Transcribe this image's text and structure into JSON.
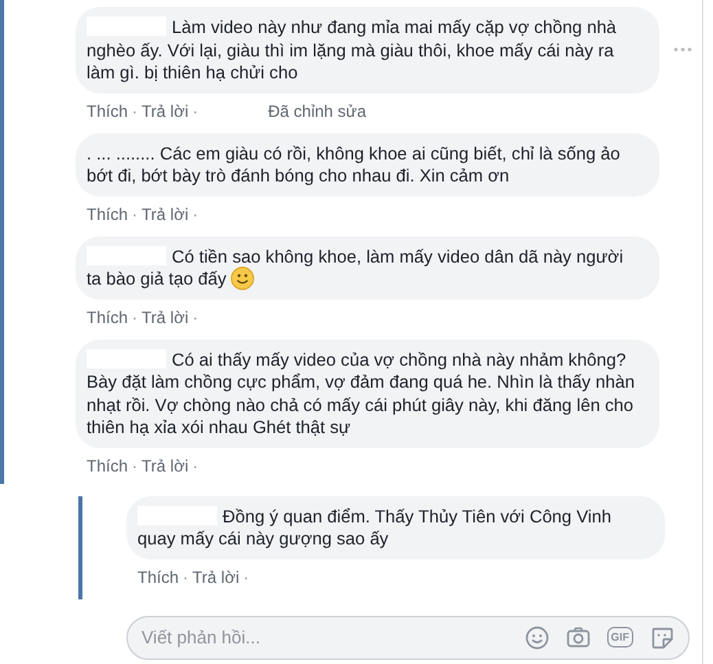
{
  "comments": [
    {
      "author_redacted": true,
      "text": "Làm video này như đang mỉa mai mấy cặp vợ chồng nhà nghèo ấy. Với lại, giàu thì im lặng mà giàu thôi, khoe mấy cái này ra làm gì. bị thiên hạ chửi cho",
      "has_emoji": false,
      "show_menu": true,
      "actions": [
        {
          "kind": "link",
          "label": "Thích"
        },
        {
          "kind": "separator",
          "label": "·"
        },
        {
          "kind": "link",
          "label": "Trả lời"
        },
        {
          "kind": "separator",
          "label": "·"
        },
        {
          "kind": "note",
          "label": "Đã chỉnh sửa"
        }
      ]
    },
    {
      "author_redacted": false,
      "text": ". ... ........ Các em giàu có rồi, không khoe ai cũng biết, chỉ là sống ảo bớt đi, bớt bày trò đánh bóng cho nhau đi. Xin cảm ơn",
      "has_emoji": false,
      "show_menu": false,
      "actions": [
        {
          "kind": "link",
          "label": "Thích"
        },
        {
          "kind": "separator",
          "label": "·"
        },
        {
          "kind": "link",
          "label": "Trả lời"
        },
        {
          "kind": "separator",
          "label": "·"
        }
      ]
    },
    {
      "author_redacted": true,
      "text": "Có tiền sao không khoe, làm mấy video dân dã này người ta bào giả tạo đấy",
      "has_emoji": true,
      "show_menu": false,
      "actions": [
        {
          "kind": "link",
          "label": "Thích"
        },
        {
          "kind": "separator",
          "label": "·"
        },
        {
          "kind": "link",
          "label": "Trả lời"
        },
        {
          "kind": "separator",
          "label": "·"
        }
      ]
    },
    {
      "author_redacted": true,
      "text": "Có ai thấy mấy video của vợ chồng nhà này nhảm không? Bày đặt làm chồng cực phẩm, vợ đảm đang quá he. Nhìn là thấy nhàn nhạt rồi. Vợ chòng nào chả có mấy cái phút giây này, khi đăng lên cho thiên hạ xỉa xói nhau Ghét thật sự",
      "has_emoji": false,
      "show_menu": false,
      "actions": [
        {
          "kind": "link",
          "label": "Thích"
        },
        {
          "kind": "separator",
          "label": "·"
        },
        {
          "kind": "link",
          "label": "Trả lời"
        },
        {
          "kind": "separator",
          "label": "·"
        }
      ],
      "replies": [
        {
          "author_redacted": true,
          "text": "Đồng ý quan điểm. Thấy Thủy Tiên với Công Vinh quay mấy cái này gượng sao ấy",
          "has_emoji": false,
          "show_menu": false,
          "actions": [
            {
              "kind": "link",
              "label": "Thích"
            },
            {
              "kind": "separator",
              "label": "·"
            },
            {
              "kind": "link",
              "label": "Trả lời"
            },
            {
              "kind": "separator",
              "label": "·"
            }
          ]
        }
      ],
      "reply_box": {
        "placeholder": "Viết phản hồi...",
        "gif_label": "GIF"
      }
    }
  ]
}
